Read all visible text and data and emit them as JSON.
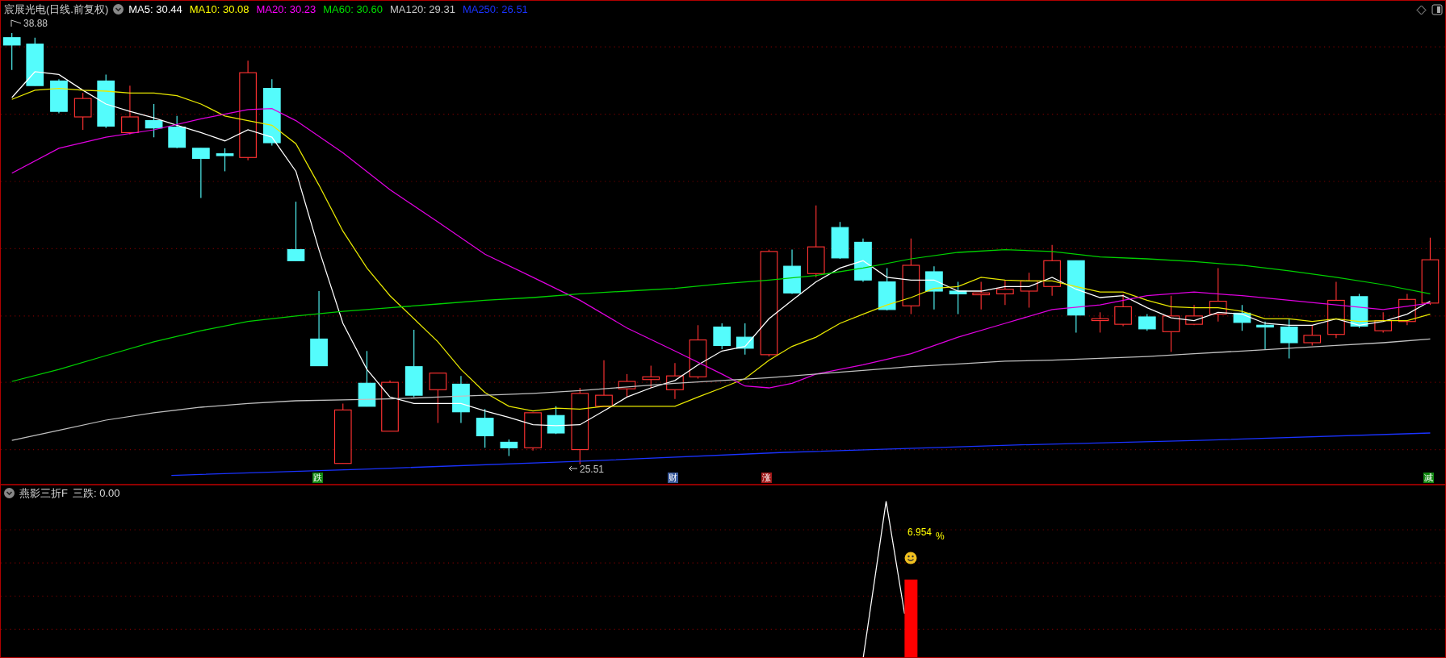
{
  "header": {
    "title": "宸展光电(日线.前复权)",
    "indicators": [
      {
        "label": "MA5: 30.44",
        "color": "#ffffff"
      },
      {
        "label": "MA10: 30.08",
        "color": "#ffff00"
      },
      {
        "label": "MA20: 30.23",
        "color": "#ff00ff"
      },
      {
        "label": "MA60: 30.60",
        "color": "#00e000"
      },
      {
        "label": "MA120: 29.31",
        "color": "#c8c8c8"
      },
      {
        "label": "MA250: 26.51",
        "color": "#1a33ff"
      }
    ]
  },
  "price_labels": {
    "high": "38.88",
    "low": "25.51"
  },
  "event_markers": [
    {
      "label": "跌",
      "color": "#118811"
    },
    {
      "label": "财",
      "color": "#3a5a9a"
    },
    {
      "label": "涨",
      "color": "#a01818"
    },
    {
      "label": "减",
      "color": "#118811"
    }
  ],
  "lower_panel": {
    "title": "燕影三折F",
    "reading": "三跌: 0.00",
    "value_label": "6.954",
    "unit": "%"
  }
}
